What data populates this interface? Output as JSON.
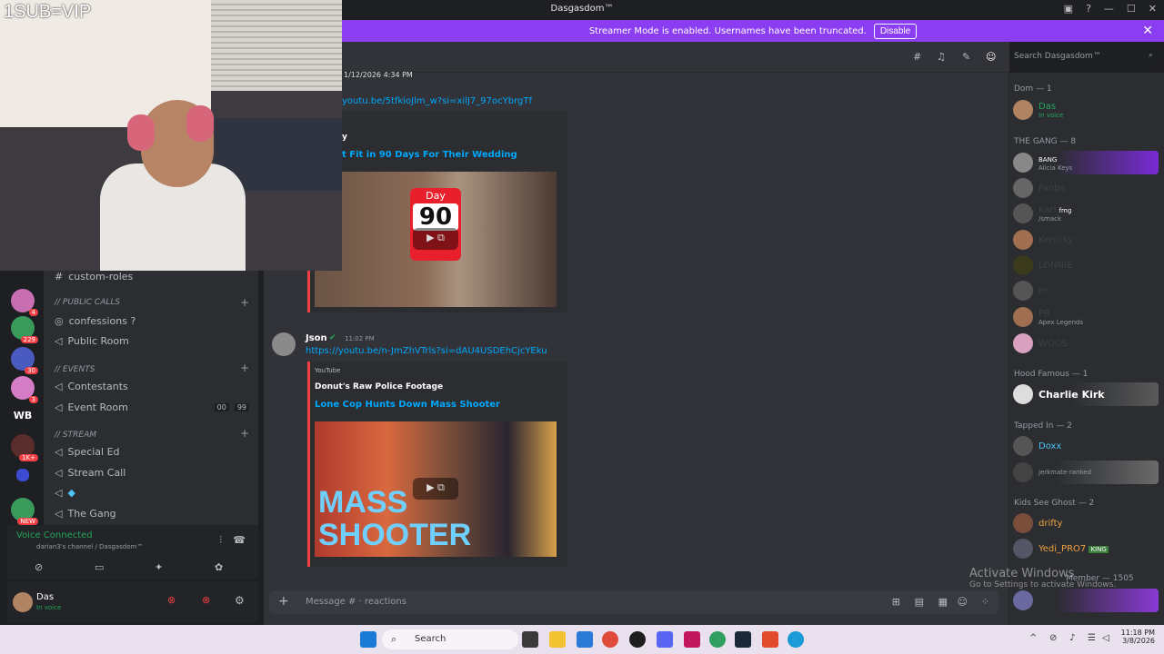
{
  "overlay_text": "1SUB=VIP",
  "window": {
    "title": "Dasgasdom™"
  },
  "banner": {
    "text": "Streamer Mode is enabled. Usernames have been truncated.",
    "button": "Disable"
  },
  "server_badges": [
    "5",
    "4",
    "229",
    "30",
    "3",
    "1K+",
    "NEW"
  ],
  "server_text": "WB",
  "channels": {
    "items": [
      {
        "name": "custom-roles",
        "top": 0
      },
      {
        "category": "// PUBLIC CALLS"
      },
      {
        "name": "confessions ?"
      },
      {
        "name": "Public Room"
      },
      {
        "category": "// Events"
      },
      {
        "name": "Contestants"
      },
      {
        "name": "Event Room",
        "count_a": "00",
        "count_b": "99"
      },
      {
        "category": "// STREAM"
      },
      {
        "name": "Special Ed"
      },
      {
        "name": "Stream Call"
      },
      {
        "name": ""
      },
      {
        "name": "The Gang"
      }
    ]
  },
  "voice": {
    "status": "Voice Connected",
    "channel": "darian3's channel / Dasgasdom™"
  },
  "user": {
    "name": "Das",
    "status": "In voice"
  },
  "chat": {
    "timestamp1": "1/12/2026 4:34 PM",
    "link1": "youtu.be/5tfkioJlm_w?si=xilJ7_97ocYbrgTf",
    "embed1_author": "y",
    "embed1_title": "t Fit in 90 Days For Their Wedding",
    "thumb1_day": "Day",
    "thumb1_num": "90",
    "msg2_user": "Json",
    "msg2_time": "11:02 PM",
    "link2": "https://youtu.be/n-JmZhVTrls?si=dAU4USDEhCjcYEku",
    "embed2_provider": "YouTube",
    "embed2_author": "Donut's Raw Police Footage",
    "embed2_title": "Lone Cop Hunts Down Mass Shooter",
    "thumb2_text1": "MASS",
    "thumb2_text2": "SHOOTER"
  },
  "search": {
    "placeholder": "Search Dasgasdom™"
  },
  "composer": {
    "placeholder": "Message # · reactions"
  },
  "members": {
    "groups": [
      {
        "label": "Dom — 1"
      },
      {
        "label": "THE GANG — 8"
      },
      {
        "label": "Hood Famous — 1"
      },
      {
        "label": "Tapped In — 2"
      },
      {
        "label": "Kids See Ghost — 2"
      }
    ],
    "das": {
      "name": "Das",
      "sub": "In voice"
    },
    "gang": [
      {
        "name": "",
        "tag": "BANG",
        "sub": "Alicia Keys"
      },
      {
        "name": "Fanbs"
      },
      {
        "name": "Karl",
        "tag": "fmg",
        "sub": "/smack"
      },
      {
        "name": "Kenicky"
      },
      {
        "name": "LONNIE"
      },
      {
        "name": "m"
      },
      {
        "name": "PR",
        "sub": "Apex Legends"
      },
      {
        "name": "WOOS"
      }
    ],
    "hood": {
      "name": "Charlie Kirk"
    },
    "tapped": [
      {
        "name": "Doxx"
      },
      {
        "name": "",
        "sub": "jerkmate-ranked"
      }
    ],
    "kids": [
      {
        "name": "drifty"
      },
      {
        "name": "Yedi_PRO7",
        "tag": "KING"
      }
    ],
    "truncated_label": "Member — 1505"
  },
  "watermark": {
    "title": "Activate Windows",
    "sub": "Go to Settings to activate Windows."
  },
  "taskbar": {
    "search": "Search",
    "time": "11:18 PM",
    "date": "3/8/2026"
  }
}
